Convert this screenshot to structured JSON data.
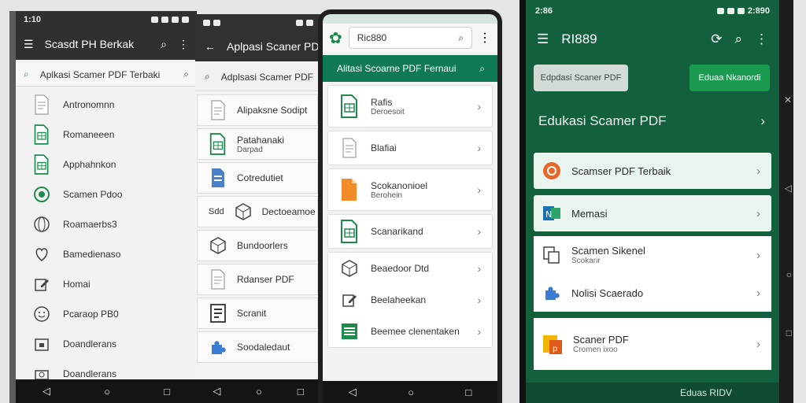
{
  "colors": {
    "green_dark": "#13603f",
    "green_banner": "#0f7a55",
    "green_button": "#1a9a4f",
    "bar_dark": "#2f3031"
  },
  "phone1": {
    "time": "1:10",
    "title": "Scasdt PH Berkak",
    "search_text": "Aplkasi Scamer PDF Terbaki",
    "items": [
      {
        "label": "Antronomnn",
        "icon": "document-icon"
      },
      {
        "label": "Romaneeen",
        "icon": "sheet-icon"
      },
      {
        "label": "Apphahnkon",
        "icon": "sheet-icon"
      },
      {
        "label": "Scamen Pdoo",
        "icon": "target-icon"
      },
      {
        "label": "Roamaerbs3",
        "icon": "globe-icon"
      },
      {
        "label": "Bamedienaso",
        "icon": "heart-icon"
      },
      {
        "label": "Homai",
        "icon": "edit-icon"
      },
      {
        "label": "Pcaraop PB0",
        "icon": "smiley-icon"
      },
      {
        "label": "Doandlerans",
        "icon": "calendar-icon"
      },
      {
        "label": "Doandlerans",
        "icon": "camera-icon"
      }
    ]
  },
  "phone2": {
    "title": "Aplpasi Scaner PDc",
    "search_text": "Adplsasi Scamer PDF",
    "items": [
      {
        "label": "Alipaksne Sodipt",
        "sub": "",
        "icon": "document-icon"
      },
      {
        "label": "Patahanaki",
        "sub": "Darpad",
        "icon": "sheet-icon"
      },
      {
        "label": "Cotredutiet",
        "sub": "",
        "icon": "document-blue-icon"
      },
      {
        "label": "Dectoeamoe",
        "sub": "",
        "icon": "cube-icon",
        "prefix": "Sdd"
      },
      {
        "label": "Bundoorlers",
        "sub": "",
        "icon": "cube-icon"
      },
      {
        "label": "Rdanser PDF",
        "sub": "",
        "icon": "document-icon"
      },
      {
        "label": "Scranit",
        "sub": "",
        "icon": "report-icon"
      },
      {
        "label": "Soodaledaut",
        "sub": "",
        "icon": "puzzle-icon"
      }
    ]
  },
  "phone3": {
    "search_value": "Ric880",
    "banner": "Alitasi Scoarne PDF Fernaui",
    "cards": [
      {
        "label": "Rafis",
        "sub": "Deroesoit",
        "icon": "sheet-icon"
      },
      {
        "label": "Blafiai",
        "sub": "",
        "icon": "document-icon"
      },
      {
        "label": "Scokanonioel",
        "sub": "Berohein",
        "icon": "document-orange-icon"
      },
      {
        "label": "Scanarikand",
        "sub": "",
        "icon": "sheet-icon"
      },
      {
        "label": "Beaedoor Dtd",
        "sub": "",
        "icon": "cube-icon"
      },
      {
        "label": "Beelaheekan",
        "sub": "",
        "icon": "edit-icon"
      },
      {
        "label": "Beemee clenentaken",
        "sub": "",
        "icon": "list-icon"
      }
    ]
  },
  "phone4": {
    "time": "2:86",
    "status_right": "2:890",
    "title": "RI889",
    "btn_secondary": "Edpdasi Scaner PDF",
    "btn_primary": "Eduaa Nkanordi",
    "section_title": "Edukasi Scamer PDF",
    "cards": [
      {
        "label": "Scamser PDF Terbaik",
        "icon": "scanner-icon"
      },
      {
        "label": "Memasi",
        "icon": "excel-icon"
      }
    ],
    "group_items": [
      {
        "label": "Scamen Sikenel",
        "sub": "Scokarir",
        "icon": "copy-icon"
      },
      {
        "label": "Nolisi Scaerado",
        "icon": "puzzle-icon"
      }
    ],
    "last_card": {
      "label": "Scaner PDF",
      "sub": "Cromen ixoo",
      "icon": "pdf-icon"
    },
    "bottom_text": "Eduas RIDV"
  }
}
